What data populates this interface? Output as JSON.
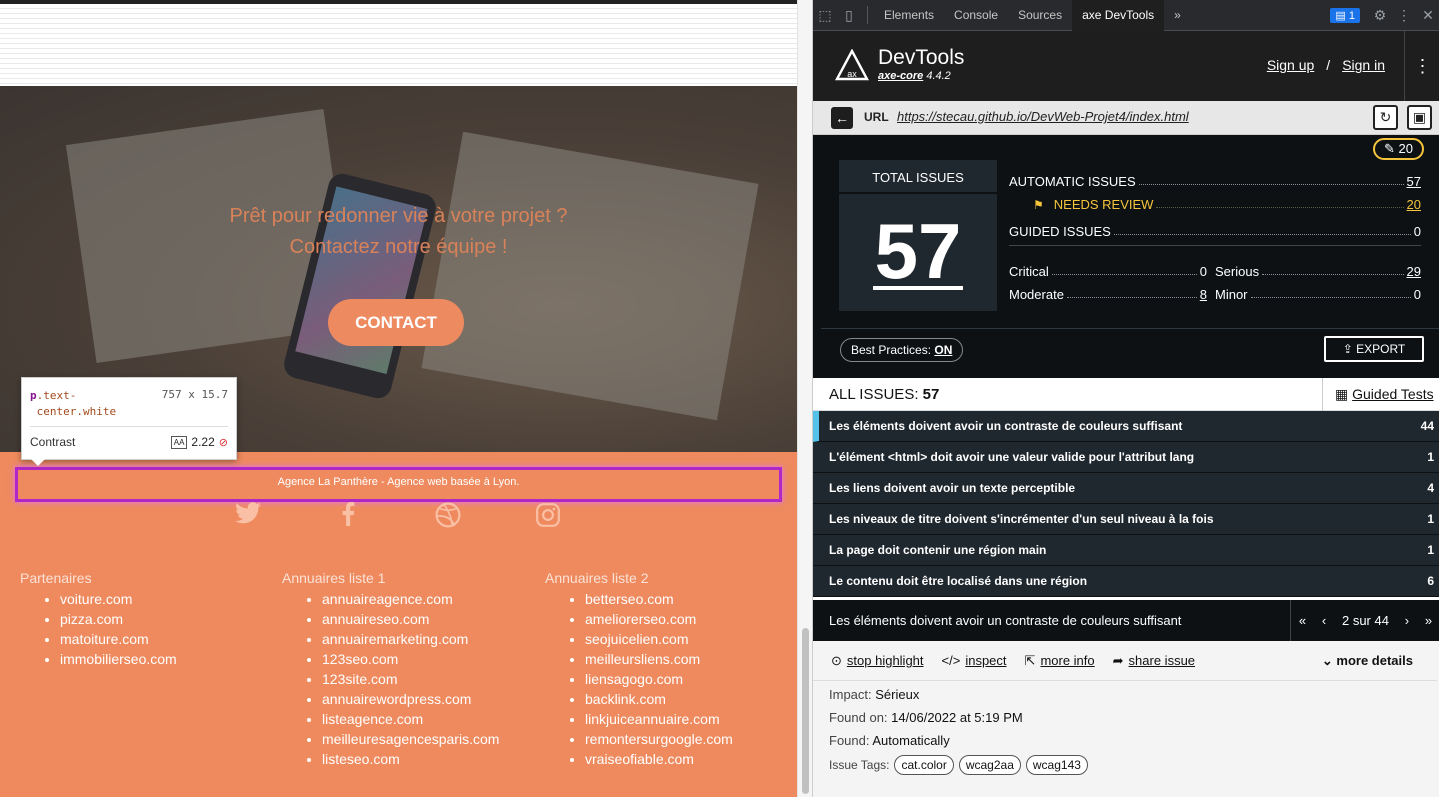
{
  "webpage": {
    "hero_line1": "Prêt pour redonner vie à votre projet ?",
    "hero_line2": "Contactez notre équipe !",
    "contact_label": "CONTACT",
    "tagline": "Agence La Panthère - Agence web basée à Lyon.",
    "social_icons": [
      "twitter-icon",
      "facebook-icon",
      "dribbble-icon",
      "instagram-icon"
    ],
    "columns": [
      {
        "title": "Partenaires",
        "items": [
          "voiture.com",
          "pizza.com",
          "matoiture.com",
          "immobilierseo.com"
        ]
      },
      {
        "title": "Annuaires liste 1",
        "items": [
          "annuaireagence.com",
          "annuaireseo.com",
          "annuairemarketing.com",
          "123seo.com",
          "123site.com",
          "annuairewordpress.com",
          "listeagence.com",
          "meilleuresagencesparis.com",
          "listeseo.com"
        ]
      },
      {
        "title": "Annuaires liste 2",
        "items": [
          "betterseo.com",
          "ameliorerseo.com",
          "seojuicelien.com",
          "meilleursliens.com",
          "liensagogo.com",
          "backlink.com",
          "linkjuiceannuaire.com",
          "remontersurgoogle.com",
          "vraiseofiable.com"
        ]
      }
    ]
  },
  "tooltip": {
    "selector_tag": "p",
    "selector_cls1": ".text-",
    "selector_cls2": "center.white",
    "size": "757 x 15.7",
    "contrast_label": "Contrast",
    "aa_badge": "AA",
    "contrast_value": "2.22"
  },
  "devtools": {
    "tabs": [
      "Elements",
      "Console",
      "Sources",
      "axe DevTools"
    ],
    "active_tab": "axe DevTools",
    "more_tabs": "»",
    "issues_badge": "1",
    "brand": "DevTools",
    "core_name": "axe-core",
    "core_version": "4.4.2",
    "sign_up": "Sign up",
    "slash": "/",
    "sign_in": "Sign in",
    "url_label": "URL",
    "url": "https://stecau.github.io/DevWeb-Projet4/index.html",
    "review_pill": "20",
    "total_label": "TOTAL ISSUES",
    "total_value": "57",
    "automatic_label": "AUTOMATIC ISSUES",
    "automatic_value": "57",
    "needs_review_label": "NEEDS REVIEW",
    "needs_review_value": "20",
    "guided_label": "GUIDED ISSUES",
    "guided_value": "0",
    "critical_label": "Critical",
    "critical_value": "0",
    "serious_label": "Serious",
    "serious_value": "29",
    "moderate_label": "Moderate",
    "moderate_value": "8",
    "minor_label": "Minor",
    "minor_value": "0",
    "best_practices_label": "Best Practices:",
    "best_practices_value": "ON",
    "export_label": "EXPORT",
    "all_issues_label": "ALL ISSUES:",
    "all_issues_value": "57",
    "guided_tests_label": "Guided Tests",
    "issues": [
      {
        "title": "Les éléments doivent avoir un contraste de couleurs suffisant",
        "count": "44"
      },
      {
        "title": "L'élément <html> doit avoir une valeur valide pour l'attribut lang",
        "count": "1"
      },
      {
        "title": "Les liens doivent avoir un texte perceptible",
        "count": "4"
      },
      {
        "title": "Les niveaux de titre doivent s'incrémenter d'un seul niveau à la fois",
        "count": "1"
      },
      {
        "title": "La page doit contenir une région main",
        "count": "1"
      },
      {
        "title": "Le contenu doit être localisé dans une région",
        "count": "6"
      }
    ],
    "selected_issue": "Les éléments doivent avoir un contraste de couleurs suffisant",
    "pager": "2 sur 44",
    "stop_highlight": "stop highlight",
    "inspect": "inspect",
    "more_info": "more info",
    "share_issue": "share issue",
    "more_details": "more details",
    "impact_label": "Impact:",
    "impact_value": "Sérieux",
    "found_on_label": "Found on:",
    "found_on_value": "14/06/2022 at 5:19 PM",
    "found_label": "Found:",
    "found_value": "Automatically",
    "tags_label": "Issue Tags:",
    "tags": [
      "cat.color",
      "wcag2aa",
      "wcag143"
    ]
  },
  "colors": {
    "footer_bg": "#ee8a5e",
    "highlight": "#b026c6",
    "axe_dark": "#0d1114",
    "review_yellow": "#f4c43c",
    "selected_accent": "#53c1e8"
  }
}
